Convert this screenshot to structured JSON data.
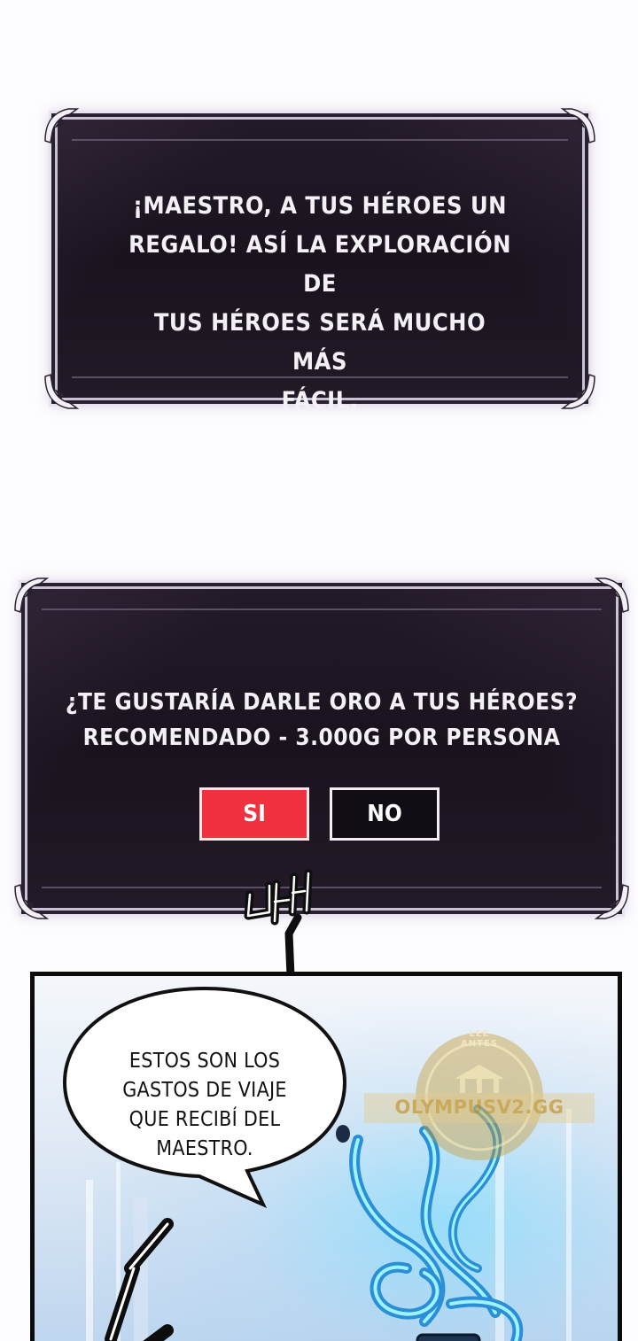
{
  "panel_top": {
    "lines": [
      "¡MAESTRO, A TUS HÉROES UN",
      "REGALO! ASÍ LA EXPLORACIÓN DE",
      "TUS HÉROES SERÁ MUCHO MÁS",
      "FÁCIL."
    ]
  },
  "panel_choice": {
    "question_line1": "¿TE GUSTARÍA DARLE ORO A TUS HÉROES?",
    "question_line2": "RECOMENDADO - 3.000G POR PERSONA",
    "yes_label": "SI",
    "no_label": "NO"
  },
  "scene": {
    "bubble_lines": [
      "ESTOS SON LOS",
      "GASTOS DE VIAJE",
      "QUE RECIBÍ DEL",
      "MAESTRO."
    ],
    "watermark_top": "LEE ANTES",
    "watermark_name": "OLYMPUSV2.GG"
  },
  "colors": {
    "panel_bg": "#1d1521",
    "panel_border": "#e8e3ee",
    "yes_button": "#f1313f",
    "no_button": "#120d14",
    "scene_glow": "#78dcff"
  }
}
